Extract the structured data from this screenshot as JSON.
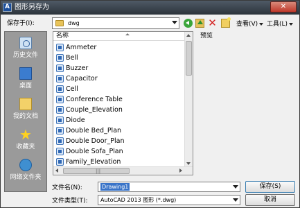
{
  "window": {
    "title": "图形另存为",
    "close_glyph": "✕"
  },
  "toolbar": {
    "save_in_label": "保存于(I):",
    "save_in_value": "dwg",
    "delete_glyph": "✕",
    "view_label": "查看(V)",
    "tools_label": "工具(L)",
    "preview_label": "预览"
  },
  "places": [
    {
      "label": "历史文件",
      "icon": "history-icon"
    },
    {
      "label": "桌面",
      "icon": "desktop-icon"
    },
    {
      "label": "我的文档",
      "icon": "documents-icon"
    },
    {
      "label": "收藏夹",
      "icon": "favorites-star-icon"
    },
    {
      "label": "网络文件夹",
      "icon": "network-folder-icon"
    }
  ],
  "filelist": {
    "column_name": "名称",
    "scroll_grip": "|||",
    "items": [
      "Ammeter",
      "Bell",
      "Buzzer",
      "Capacitor",
      "Cell",
      "Conference Table",
      "Couple_Elevation",
      "Diode",
      "Double Bed_Plan",
      "Double Door_Plan",
      "Double Sofa_Plan",
      "Family_Elevation"
    ]
  },
  "bottom": {
    "filename_label": "文件名(N):",
    "filename_value": "Drawing1",
    "filetype_label": "文件类型(T):",
    "filetype_value": "AutoCAD 2013 图形 (*.dwg)",
    "save_button": "保存(S)",
    "cancel_button": "取消"
  },
  "colors": {
    "title_bar": "#2c333b",
    "places_bar": "#9a9a9a",
    "selection": "#3a74c8",
    "close_button": "#c0392b"
  }
}
